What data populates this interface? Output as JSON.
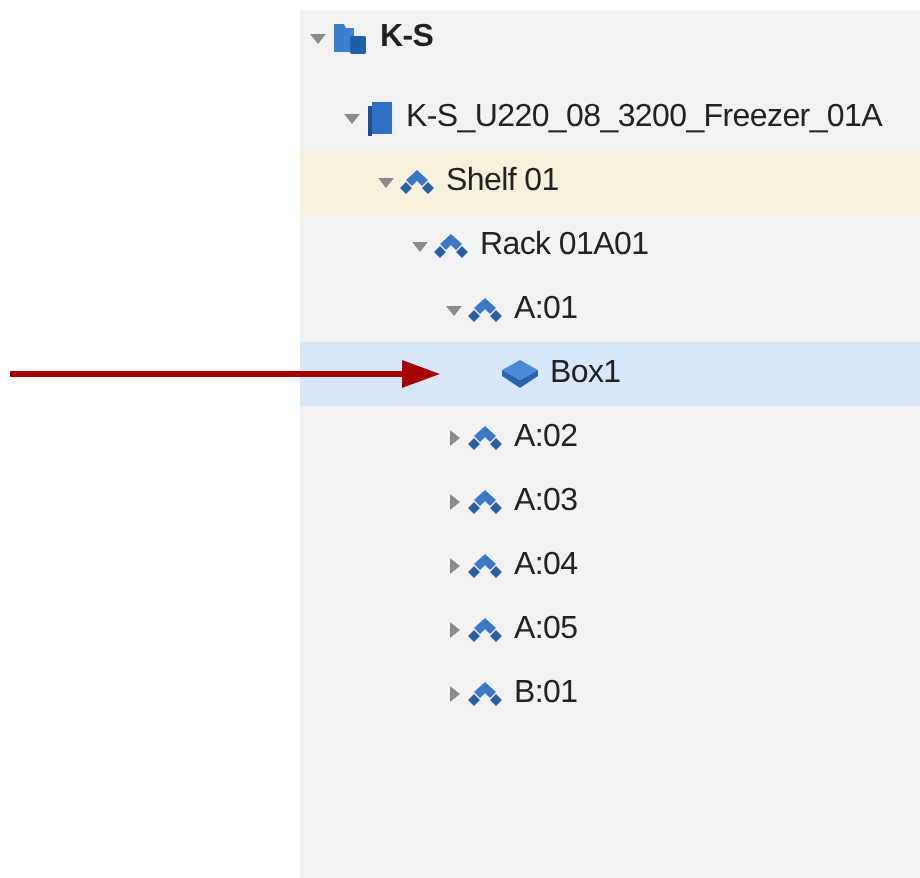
{
  "tree": [
    {
      "label": "K-S",
      "kind": "site",
      "expanded": true,
      "selected": false,
      "highlighted": false,
      "children": [
        {
          "label": "K-S_U220_08_3200_Freezer_01A",
          "kind": "freezer",
          "expanded": true,
          "selected": false,
          "highlighted": false,
          "children": [
            {
              "label": "Shelf 01",
              "kind": "container",
              "expanded": true,
              "selected": false,
              "highlighted": true,
              "children": [
                {
                  "label": "Rack 01A01",
                  "kind": "container",
                  "expanded": true,
                  "selected": false,
                  "highlighted": false,
                  "children": [
                    {
                      "label": "A:01",
                      "kind": "container",
                      "expanded": true,
                      "selected": false,
                      "highlighted": false,
                      "children": [
                        {
                          "label": "Box1",
                          "kind": "box",
                          "selected": true,
                          "highlighted": false
                        }
                      ]
                    },
                    {
                      "label": "A:02",
                      "kind": "container",
                      "expanded": false,
                      "selected": false,
                      "highlighted": false
                    },
                    {
                      "label": "A:03",
                      "kind": "container",
                      "expanded": false,
                      "selected": false,
                      "highlighted": false
                    },
                    {
                      "label": "A:04",
                      "kind": "container",
                      "expanded": false,
                      "selected": false,
                      "highlighted": false
                    },
                    {
                      "label": "A:05",
                      "kind": "container",
                      "expanded": false,
                      "selected": false,
                      "highlighted": false
                    },
                    {
                      "label": "B:01",
                      "kind": "container",
                      "expanded": false,
                      "selected": false,
                      "highlighted": false
                    }
                  ]
                }
              ]
            }
          ]
        }
      ]
    }
  ]
}
